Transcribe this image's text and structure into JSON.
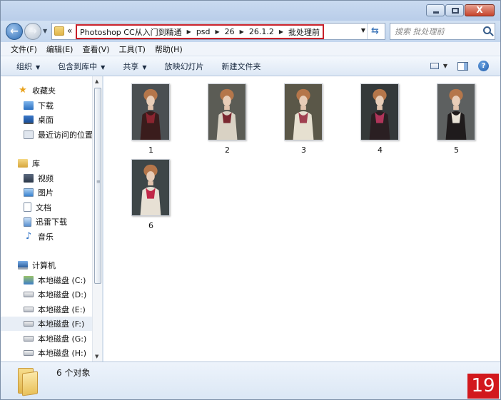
{
  "window": {
    "buttons": {
      "minimize": "minimize",
      "maximize": "maximize",
      "close": "X"
    }
  },
  "address": {
    "overflow": "«",
    "breadcrumbs": [
      "Photoshop CC从入门到精通",
      "psd",
      "26",
      "26.1.2",
      "批处理前"
    ]
  },
  "search": {
    "placeholder": "搜索 批处理前"
  },
  "menu": [
    "文件(F)",
    "编辑(E)",
    "查看(V)",
    "工具(T)",
    "帮助(H)"
  ],
  "commands": [
    {
      "label": "组织",
      "dropdown": true
    },
    {
      "label": "包含到库中",
      "dropdown": true
    },
    {
      "label": "共享",
      "dropdown": true
    },
    {
      "label": "放映幻灯片",
      "dropdown": false
    },
    {
      "label": "新建文件夹",
      "dropdown": false
    }
  ],
  "nav": {
    "favorites": {
      "label": "收藏夹",
      "icon": "star-icon",
      "items": [
        {
          "label": "下载",
          "icon": "download-icon"
        },
        {
          "label": "桌面",
          "icon": "desktop-icon"
        },
        {
          "label": "最近访问的位置",
          "icon": "recent-places-icon"
        }
      ]
    },
    "libraries": {
      "label": "库",
      "icon": "library-icon",
      "items": [
        {
          "label": "视频",
          "icon": "video-icon"
        },
        {
          "label": "图片",
          "icon": "pictures-icon"
        },
        {
          "label": "文档",
          "icon": "documents-icon"
        },
        {
          "label": "迅雷下载",
          "icon": "xunlei-download-icon"
        },
        {
          "label": "音乐",
          "icon": "music-icon"
        }
      ]
    },
    "computer": {
      "label": "计算机",
      "icon": "computer-icon",
      "drives": [
        {
          "label": "本地磁盘 (C:)",
          "icon": "system-drive-icon",
          "selected": false
        },
        {
          "label": "本地磁盘 (D:)",
          "icon": "drive-icon",
          "selected": false
        },
        {
          "label": "本地磁盘 (E:)",
          "icon": "drive-icon",
          "selected": false
        },
        {
          "label": "本地磁盘 (F:)",
          "icon": "drive-icon",
          "selected": true
        },
        {
          "label": "本地磁盘 (G:)",
          "icon": "drive-icon",
          "selected": false
        },
        {
          "label": "本地磁盘 (H:)",
          "icon": "drive-icon",
          "selected": false
        }
      ]
    }
  },
  "files": [
    {
      "name": "1",
      "bg": "#4a4f52",
      "dress": "#3a1c1c",
      "accent": "#8a2530"
    },
    {
      "name": "2",
      "bg": "#5b5c55",
      "dress": "#d9d2c4",
      "accent": "#7a2830"
    },
    {
      "name": "3",
      "bg": "#5a5748",
      "dress": "#e6e0d0",
      "accent": "#a04050"
    },
    {
      "name": "4",
      "bg": "#34393a",
      "dress": "#2a1f22",
      "accent": "#b0355a"
    },
    {
      "name": "5",
      "bg": "#5d6060",
      "dress": "#1f1b1c",
      "accent": "#e8e2d6"
    },
    {
      "name": "6",
      "bg": "#3e4648",
      "dress": "#e7e0d4",
      "accent": "#c02848"
    }
  ],
  "details": {
    "count_text": "6 个对象"
  },
  "badge": "19",
  "colors": {
    "highlight_box": "#c8202a",
    "badge": "#d2181d"
  }
}
